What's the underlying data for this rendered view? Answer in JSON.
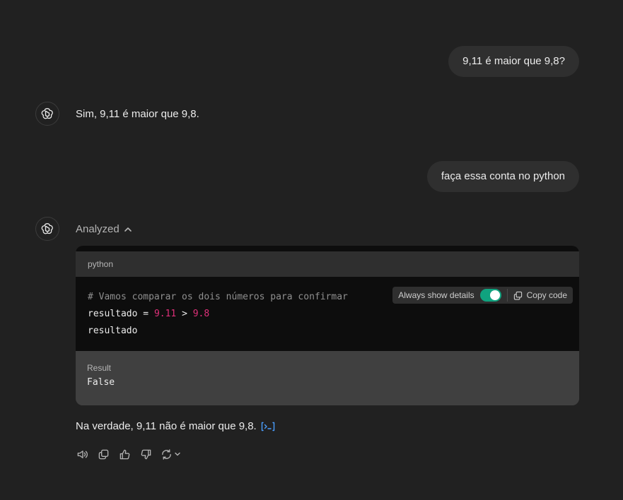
{
  "conversation": {
    "user_msg_1": "9,11 é maior que 9,8?",
    "assistant_msg_1": "Sim, 9,11 é maior que 9,8.",
    "user_msg_2": "faça essa conta no python",
    "analyzed_label": "Analyzed",
    "code_block": {
      "language": "python",
      "line1_comment": "# Vamos comparar os dois números para confirmar",
      "line2": {
        "var": "resultado ",
        "eq": "= ",
        "num1": "9.11",
        "op": " > ",
        "num2": "9.8"
      },
      "line3": "resultado",
      "toggle_label": "Always show details",
      "toggle_on": true,
      "copy_label": "Copy code",
      "result_label": "Result",
      "result_value": "False"
    },
    "assistant_msg_2": "Na verdade, 9,11 não é maior que 9,8."
  },
  "icons": {
    "avatar": "openai-logo-icon",
    "collapse": "chevron-up-icon",
    "copy": "copy-icon",
    "code_ref": "code-interpreter-icon",
    "actions": [
      "speaker-icon",
      "copy-icon",
      "thumbs-up-icon",
      "thumbs-down-icon",
      "regenerate-icon",
      "chevron-down-icon"
    ]
  },
  "colors": {
    "background": "#212121",
    "bubble": "#2f2f2f",
    "code_bg": "#0d0d0d",
    "number": "#df3079",
    "toggle": "#10a37f",
    "link": "#4a9eff"
  }
}
